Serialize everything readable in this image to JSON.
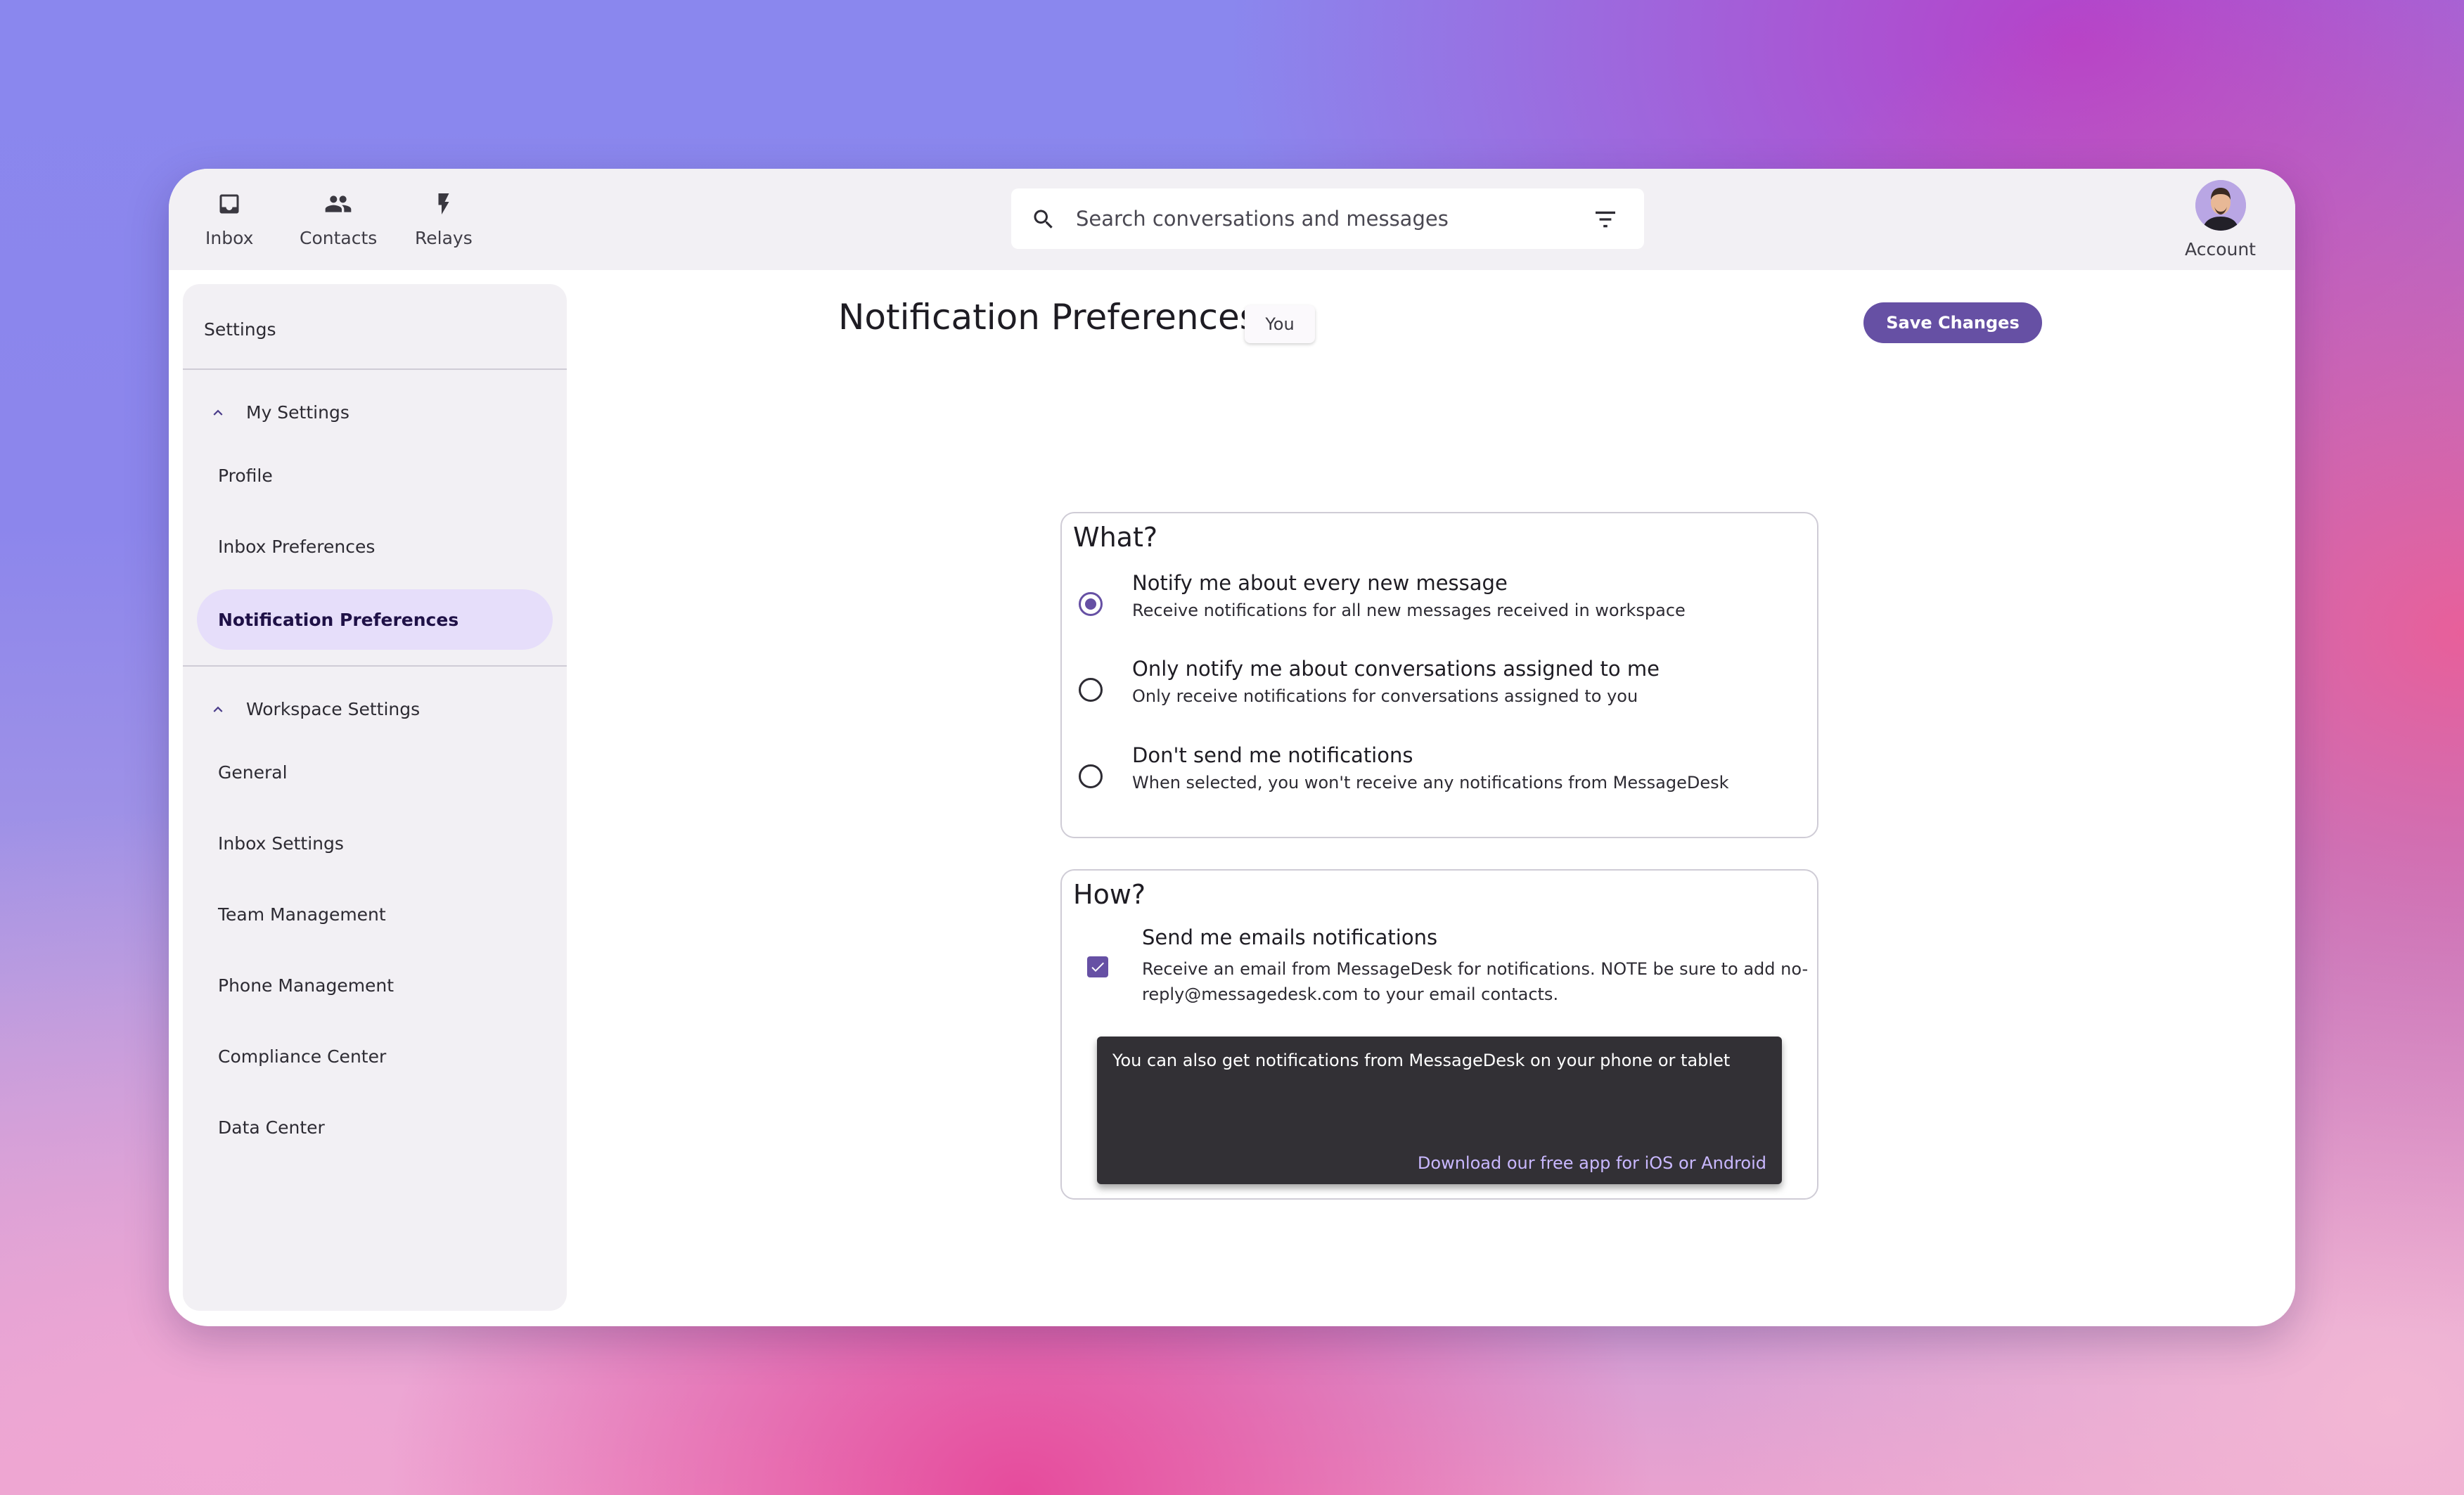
{
  "nav": {
    "items": [
      {
        "label": "Inbox",
        "icon": "inbox-icon"
      },
      {
        "label": "Contacts",
        "icon": "contacts-icon"
      },
      {
        "label": "Relays",
        "icon": "bolt-icon"
      }
    ],
    "account_label": "Account"
  },
  "search": {
    "placeholder": "Search conversations and messages"
  },
  "sidebar": {
    "title": "Settings",
    "my_settings": {
      "label": "My Settings",
      "items": [
        "Profile",
        "Inbox Preferences",
        "Notification Preferences"
      ],
      "active": "Notification Preferences"
    },
    "workspace_settings": {
      "label": "Workspace Settings",
      "items": [
        "General",
        "Inbox Settings",
        "Team Management",
        "Phone Management",
        "Compliance Center",
        "Data Center"
      ]
    }
  },
  "main": {
    "title": "Notification Preferences",
    "badge": "You",
    "save_label": "Save Changes",
    "what": {
      "title": "What?",
      "options": [
        {
          "title": "Notify me about every new message",
          "desc": "Receive notifications for all new messages received in workspace",
          "checked": true
        },
        {
          "title": "Only notify me about conversations assigned to me",
          "desc": "Only receive notifications for conversations assigned to you",
          "checked": false
        },
        {
          "title": "Don't send me notifications",
          "desc": "When selected, you won't receive any notifications from MessageDesk",
          "checked": false
        }
      ]
    },
    "how": {
      "title": "How?",
      "email_title": "Send me emails notifications",
      "email_desc": "Receive an email from MessageDesk for notifications. NOTE be sure to add no-reply@messagedesk.com to your email contacts.",
      "email_checked": true,
      "promo_text": "You can also get notifications from MessageDesk on your phone or tablet",
      "promo_link": "Download our free app for iOS or Android"
    }
  },
  "colors": {
    "accent": "#6650a4",
    "active_bg": "#e6defa",
    "sidebar_bg": "#f2f0f4",
    "promo_bg": "#323035",
    "link": "#c9b8ff"
  }
}
